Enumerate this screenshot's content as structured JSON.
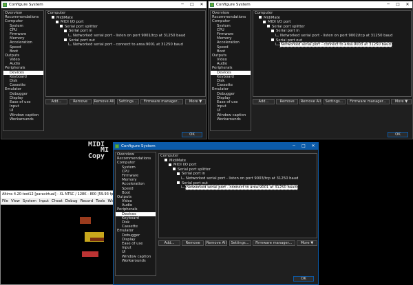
{
  "dialog": {
    "title": "Configure System",
    "close_glyph": "✕",
    "min_glyph": "─",
    "max_glyph": "□"
  },
  "sidebar": [
    {
      "label": "Overview",
      "level": "sec"
    },
    {
      "label": "Recommendations",
      "level": "sec"
    },
    {
      "label": "Computer",
      "level": "sec"
    },
    {
      "label": "System",
      "level": "it"
    },
    {
      "label": "CPU",
      "level": "it"
    },
    {
      "label": "Firmware",
      "level": "it"
    },
    {
      "label": "Memory",
      "level": "it"
    },
    {
      "label": "Acceleration",
      "level": "it"
    },
    {
      "label": "Speed",
      "level": "it"
    },
    {
      "label": "Boot",
      "level": "it"
    },
    {
      "label": "Outputs",
      "level": "sec"
    },
    {
      "label": "Video",
      "level": "it"
    },
    {
      "label": "Audio",
      "level": "it"
    },
    {
      "label": "Peripherals",
      "level": "sec"
    },
    {
      "label": "Devices",
      "level": "it",
      "selected": true
    },
    {
      "label": "Keyboard",
      "level": "it"
    },
    {
      "label": "Disk",
      "level": "it"
    },
    {
      "label": "Cassette",
      "level": "it"
    },
    {
      "label": "Emulator",
      "level": "sec"
    },
    {
      "label": "Debugger",
      "level": "it"
    },
    {
      "label": "Display",
      "level": "it"
    },
    {
      "label": "Ease of use",
      "level": "it"
    },
    {
      "label": "Input",
      "level": "it"
    },
    {
      "label": "UI",
      "level": "it"
    },
    {
      "label": "Window caption",
      "level": "it"
    },
    {
      "label": "Workarounds",
      "level": "it"
    }
  ],
  "windows": [
    {
      "tree": [
        {
          "label": "Computer",
          "indent": 0,
          "box": false
        },
        {
          "label": "MidiMate",
          "indent": 1,
          "box": true
        },
        {
          "label": "MIDI I/O port",
          "indent": 2,
          "box": true
        },
        {
          "label": "Serial port splitter",
          "indent": 3,
          "box": true
        },
        {
          "label": "Serial port in",
          "indent": 4,
          "box": true
        },
        {
          "label": "Networked serial port - listen on port 9001/tcp at 31250 baud",
          "indent": 5,
          "link": true
        },
        {
          "label": "Serial port out",
          "indent": 4,
          "box": true
        },
        {
          "label": "Networked serial port - connect to area:9001 at 31250 baud",
          "indent": 5,
          "link": true
        }
      ]
    },
    {
      "tree": [
        {
          "label": "Computer",
          "indent": 0,
          "box": false
        },
        {
          "label": "MidiMate",
          "indent": 1,
          "box": true
        },
        {
          "label": "MIDI I/O port",
          "indent": 2,
          "box": true
        },
        {
          "label": "Serial port splitter",
          "indent": 3,
          "box": true
        },
        {
          "label": "Serial port in",
          "indent": 4,
          "box": true
        },
        {
          "label": "Networked serial port - listen on port 9002/tcp at 31250 baud",
          "indent": 5,
          "link": true
        },
        {
          "label": "Serial port out",
          "indent": 4,
          "box": true
        },
        {
          "label": "Networked serial port - connect to area:9003 at 31250 baud",
          "indent": 5,
          "link": true,
          "highlight": true
        }
      ]
    },
    {
      "tree": [
        {
          "label": "Computer",
          "indent": 0,
          "box": false
        },
        {
          "label": "MidiMate",
          "indent": 1,
          "box": true
        },
        {
          "label": "MIDI I/O port",
          "indent": 2,
          "box": true
        },
        {
          "label": "Serial port splitter",
          "indent": 3,
          "box": true
        },
        {
          "label": "Serial port in",
          "indent": 4,
          "box": true
        },
        {
          "label": "Networked serial port - listen on port 9003/tcp at 31250 baud",
          "indent": 5,
          "link": true
        },
        {
          "label": "Serial port out",
          "indent": 4,
          "box": true
        },
        {
          "label": "Networked serial port - connect to area:9001 at 31250 baud",
          "indent": 5,
          "link": true,
          "highlight": true
        }
      ]
    }
  ],
  "buttons": {
    "add": "Add...",
    "remove": "Remove",
    "remove_all": "Remove All",
    "settings": "Settings...",
    "firmware": "Firmware manager...",
    "more": "More ▼",
    "ok": "OK"
  },
  "emulator": {
    "title": "Altirra 4.20-test12 [paravirtual] - XL NTSC / 128K - 800 [59.93 fps] (10.0",
    "menu": [
      "File",
      "View",
      "System",
      "Input",
      "Cheat",
      "Debug",
      "Record",
      "Tools",
      "Window"
    ],
    "screen_text": [
      "MIDI",
      "MI",
      "Copy"
    ]
  },
  "colors": {
    "accent": "#0b5aa8",
    "panel": "#191919",
    "window": "#1f1f1f"
  }
}
